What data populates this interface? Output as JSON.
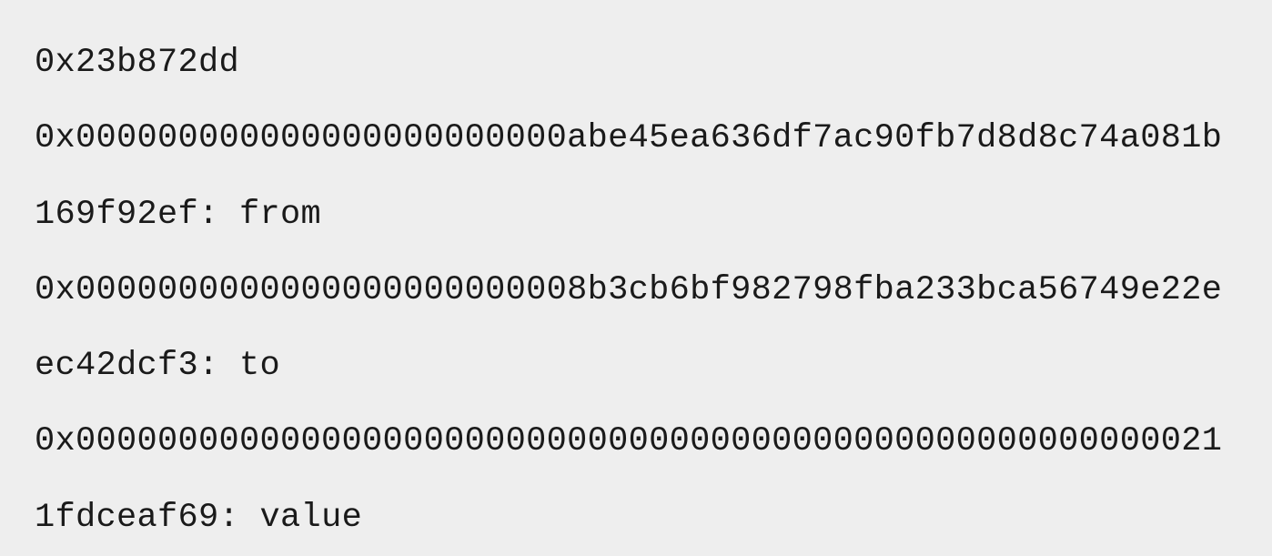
{
  "code": {
    "selector": "0x23b872dd",
    "param1_hex": "0x000000000000000000000000abe45ea636df7ac90fb7d8d8c74a081b169f92ef",
    "param1_label": ": from",
    "param2_hex": "0x0000000000000000000000008b3cb6bf982798fba233bca56749e22eec42dcf3",
    "param2_label": ": to",
    "param3_hex": "0x000000000000000000000000000000000000000000000000000000211fdceaf69",
    "param3_label": ": value"
  }
}
